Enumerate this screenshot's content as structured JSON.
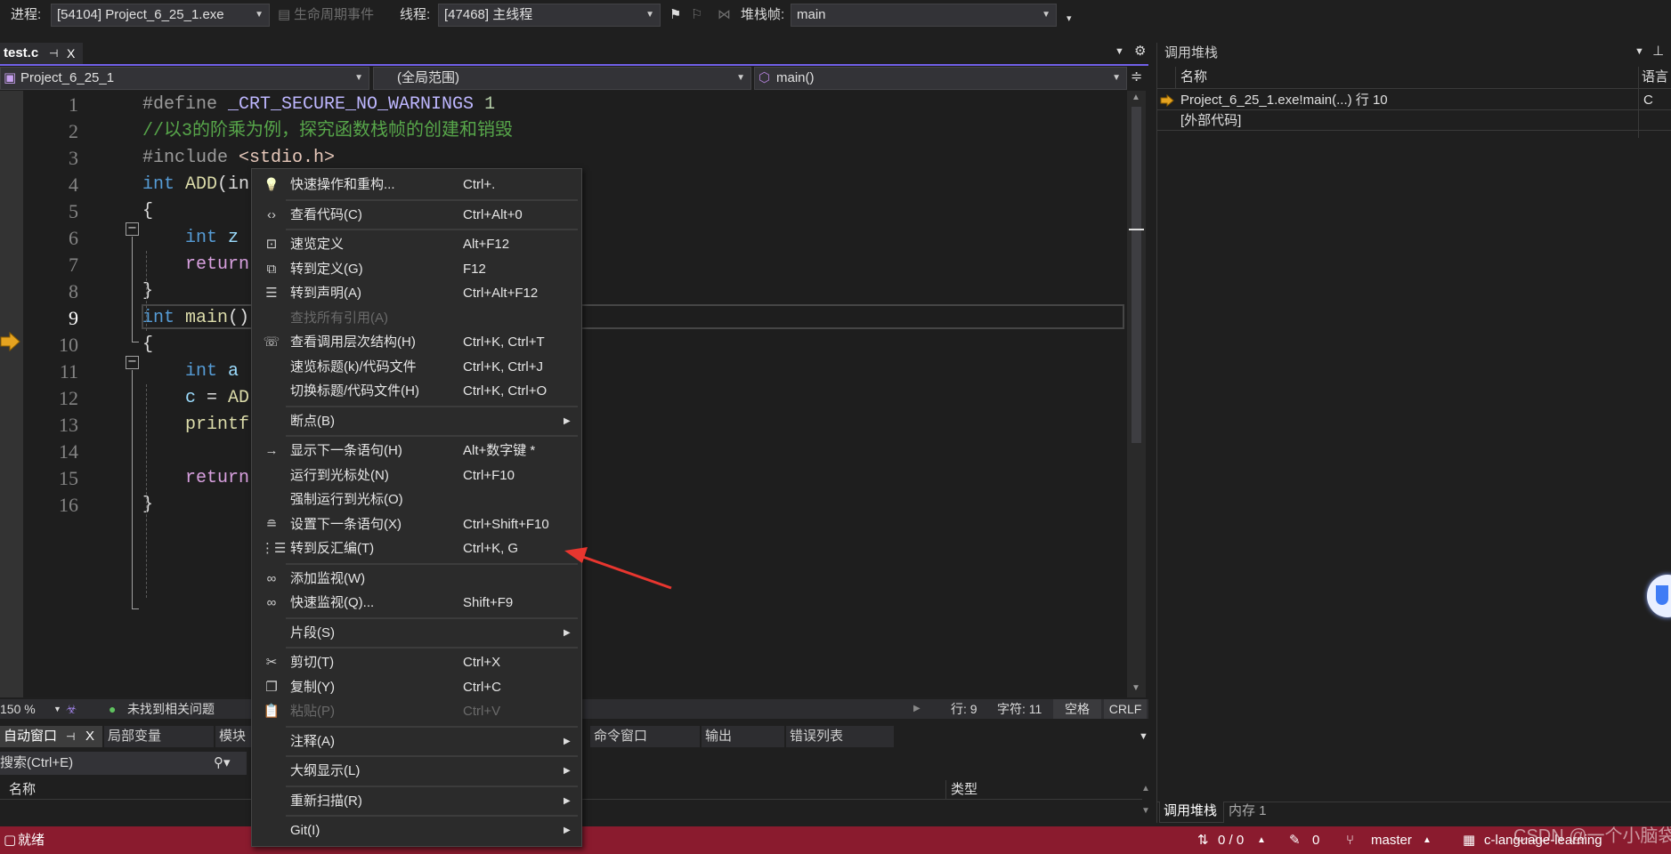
{
  "toolbar": {
    "process_label": "进程:",
    "process_value": "[54104] Project_6_25_1.exe",
    "lifecycle_label": "生命周期事件",
    "thread_label": "线程:",
    "thread_value": "[47468] 主线程",
    "stackframe_label": "堆栈帧:",
    "stackframe_value": "main"
  },
  "editor_tab": {
    "name": "test.c",
    "pin": "⊣",
    "close": "X"
  },
  "navbar": {
    "project": "Project_6_25_1",
    "scope": "(全局范围)",
    "member": "main()"
  },
  "code": {
    "current_line": 9,
    "execution_line": 10,
    "lines": [
      [
        {
          "t": "#define ",
          "c": "pp"
        },
        {
          "t": "_CRT_SECURE_NO_WARNINGS",
          "c": "macro"
        },
        {
          "t": " 1",
          "c": "num"
        }
      ],
      [
        {
          "t": "//以3的阶乘为例，探究函数栈帧的创建和销毁",
          "c": "cm"
        }
      ],
      [
        {
          "t": "#include ",
          "c": "pp"
        },
        {
          "t": "<stdio.h>",
          "c": "str"
        }
      ],
      [
        {
          "t": "int ",
          "c": "kw"
        },
        {
          "t": "ADD",
          "c": "fn"
        },
        {
          "t": "(in",
          "c": "pl"
        }
      ],
      [
        {
          "t": "{",
          "c": "pl"
        }
      ],
      [
        {
          "t": "    ",
          "c": "pl"
        },
        {
          "t": "int ",
          "c": "kw"
        },
        {
          "t": "z",
          "c": "var"
        }
      ],
      [
        {
          "t": "    ",
          "c": "pl"
        },
        {
          "t": "return",
          "c": "ctl"
        }
      ],
      [
        {
          "t": "}",
          "c": "pl"
        }
      ],
      [
        {
          "t": "int ",
          "c": "kw"
        },
        {
          "t": "main",
          "c": "fn"
        },
        {
          "t": "()",
          "c": "pl"
        }
      ],
      [
        {
          "t": "{",
          "c": "pl"
        }
      ],
      [
        {
          "t": "    ",
          "c": "pl"
        },
        {
          "t": "int ",
          "c": "kw"
        },
        {
          "t": "a",
          "c": "var"
        }
      ],
      [
        {
          "t": "    ",
          "c": "pl"
        },
        {
          "t": "c",
          "c": "var"
        },
        {
          "t": " = ",
          "c": "pl"
        },
        {
          "t": "AD",
          "c": "fn"
        }
      ],
      [
        {
          "t": "    ",
          "c": "pl"
        },
        {
          "t": "printf",
          "c": "fn"
        }
      ],
      [],
      [
        {
          "t": "    ",
          "c": "pl"
        },
        {
          "t": "return",
          "c": "ctl"
        }
      ],
      [
        {
          "t": "}",
          "c": "pl"
        }
      ]
    ]
  },
  "context_menu": [
    {
      "icon": "lightbulb",
      "label": "快速操作和重构...",
      "shortcut": "Ctrl+."
    },
    {
      "sep": true
    },
    {
      "icon": "code",
      "label": "查看代码(C)",
      "shortcut": "Ctrl+Alt+0"
    },
    {
      "sep": true
    },
    {
      "icon": "peek-definition",
      "label": "速览定义",
      "shortcut": "Alt+F12"
    },
    {
      "icon": "go-to-definition",
      "label": "转到定义(G)",
      "shortcut": "F12"
    },
    {
      "icon": "go-to-declaration",
      "label": "转到声明(A)",
      "shortcut": "Ctrl+Alt+F12"
    },
    {
      "icon": "",
      "label": "查找所有引用(A)",
      "shortcut": "",
      "disabled": true
    },
    {
      "icon": "call-hierarchy",
      "label": "查看调用层次结构(H)",
      "shortcut": "Ctrl+K, Ctrl+T"
    },
    {
      "icon": "",
      "label": "速览标题(k)/代码文件",
      "shortcut": "Ctrl+K, Ctrl+J"
    },
    {
      "icon": "",
      "label": "切换标题/代码文件(H)",
      "shortcut": "Ctrl+K, Ctrl+O"
    },
    {
      "sep": true
    },
    {
      "icon": "",
      "label": "断点(B)",
      "shortcut": "",
      "submenu": true
    },
    {
      "sep": true
    },
    {
      "icon": "arrow-right",
      "label": "显示下一条语句(H)",
      "shortcut": "Alt+数字键 *"
    },
    {
      "icon": "",
      "label": "运行到光标处(N)",
      "shortcut": "Ctrl+F10"
    },
    {
      "icon": "",
      "label": "强制运行到光标(O)",
      "shortcut": ""
    },
    {
      "icon": "set-next-statement",
      "label": "设置下一条语句(X)",
      "shortcut": "Ctrl+Shift+F10"
    },
    {
      "icon": "disassembly",
      "label": "转到反汇编(T)",
      "shortcut": "Ctrl+K, G"
    },
    {
      "sep": true
    },
    {
      "icon": "glasses",
      "label": "添加监视(W)",
      "shortcut": ""
    },
    {
      "icon": "glasses",
      "label": "快速监视(Q)...",
      "shortcut": "Shift+F9"
    },
    {
      "sep": true
    },
    {
      "icon": "",
      "label": "片段(S)",
      "shortcut": "",
      "submenu": true
    },
    {
      "sep": true
    },
    {
      "icon": "scissors",
      "label": "剪切(T)",
      "shortcut": "Ctrl+X"
    },
    {
      "icon": "copy",
      "label": "复制(Y)",
      "shortcut": "Ctrl+C"
    },
    {
      "icon": "paste",
      "label": "粘贴(P)",
      "shortcut": "Ctrl+V",
      "disabled": true
    },
    {
      "sep": true
    },
    {
      "icon": "",
      "label": "注释(A)",
      "shortcut": "",
      "submenu": true
    },
    {
      "sep": true
    },
    {
      "icon": "",
      "label": "大纲显示(L)",
      "shortcut": "",
      "submenu": true
    },
    {
      "sep": true
    },
    {
      "icon": "",
      "label": "重新扫描(R)",
      "shortcut": "",
      "submenu": true
    },
    {
      "sep": true
    },
    {
      "icon": "",
      "label": "Git(I)",
      "shortcut": "",
      "submenu": true
    }
  ],
  "editor_status": {
    "zoom": "150 %",
    "issues": "未找到相关问题",
    "line": "行: 9",
    "char": "字符: 11",
    "spaces": "空格",
    "eol": "CRLF"
  },
  "bottom_panel": {
    "tabs": [
      "自动窗口",
      "局部变量",
      "模块",
      "命令窗口",
      "输出",
      "错误列表"
    ],
    "search_placeholder": "搜索(Ctrl+E)",
    "columns": [
      "名称",
      "类型"
    ]
  },
  "call_stack": {
    "title": "调用堆栈",
    "columns": [
      "名称",
      "语言"
    ],
    "rows": [
      {
        "name": "Project_6_25_1.exe!main(...) 行 10",
        "lang": "C",
        "current": true
      },
      {
        "name": "[外部代码]",
        "lang": ""
      }
    ],
    "tabs": [
      "调用堆栈",
      "内存 1"
    ]
  },
  "statusbar": {
    "ready": "就绪",
    "sync": "0 / 0",
    "changes": "0",
    "branch": "master",
    "repo": "c-language-learning",
    "watermark": "CSDN @一个小脑袋"
  },
  "colors": {
    "accent": "#7160e8",
    "statusbar": "#8a1b2e",
    "annotation_arrow": "#e8362f"
  }
}
